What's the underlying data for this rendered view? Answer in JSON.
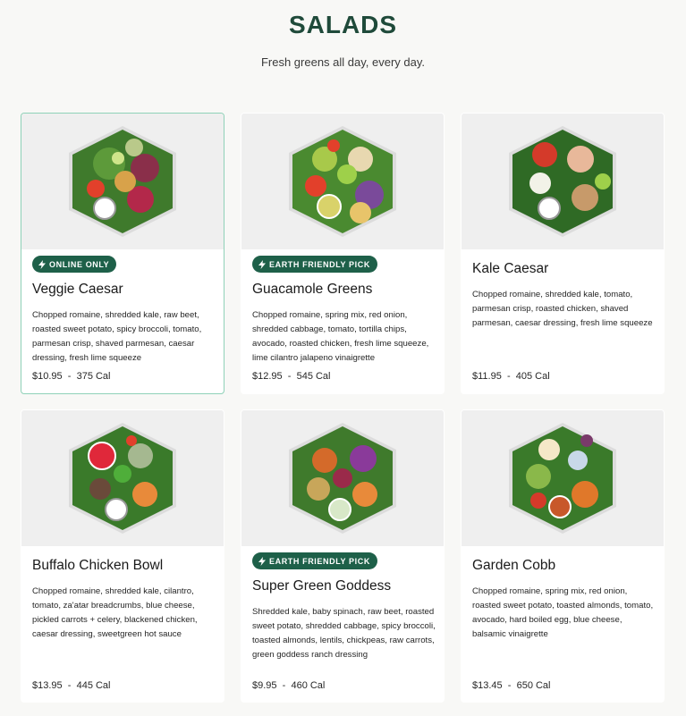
{
  "page": {
    "title": "SALADS",
    "subtitle": "Fresh greens all day, every day."
  },
  "products": [
    {
      "name": "Veggie Caesar",
      "badge": "ONLINE ONLY",
      "description": "Chopped romaine, shredded kale, raw beet, roasted sweet potato, spicy broccoli, tomato, parmesan crisp, shaved parmesan, caesar dressing, fresh lime squeeze",
      "price": "$10.95",
      "separator": "-",
      "calories": "375 Cal",
      "selected": true
    },
    {
      "name": "Guacamole Greens",
      "badge": "EARTH FRIENDLY PICK",
      "description": "Chopped romaine, spring mix, red onion, shredded cabbage, tomato, tortilla chips, avocado, roasted chicken, fresh lime squeeze, lime cilantro jalapeno vinaigrette",
      "price": "$12.95",
      "separator": "-",
      "calories": "545 Cal",
      "selected": false
    },
    {
      "name": "Kale Caesar",
      "badge": "",
      "description": "Chopped romaine, shredded kale, tomato, parmesan crisp, roasted chicken, shaved parmesan, caesar dressing, fresh lime squeeze",
      "price": "$11.95",
      "separator": "-",
      "calories": "405 Cal",
      "selected": false
    },
    {
      "name": "Buffalo Chicken Bowl",
      "badge": "",
      "description": "Chopped romaine, shredded kale, cilantro, tomato, za'atar breadcrumbs, blue cheese, pickled carrots + celery, blackened chicken, caesar dressing, sweetgreen hot sauce",
      "price": "$13.95",
      "separator": "-",
      "calories": "445 Cal",
      "selected": false
    },
    {
      "name": "Super Green Goddess",
      "badge": "EARTH FRIENDLY PICK",
      "description": "Shredded kale, baby spinach, raw beet, roasted sweet potato, shredded cabbage, spicy broccoli, toasted almonds, lentils, chickpeas, raw carrots, green goddess ranch dressing",
      "price": "$9.95",
      "separator": "-",
      "calories": "460 Cal",
      "selected": false
    },
    {
      "name": "Garden Cobb",
      "badge": "",
      "description": "Chopped romaine, spring mix, red onion, roasted sweet potato, toasted almonds, tomato, avocado, hard boiled egg, blue cheese, balsamic vinaigrette",
      "price": "$13.45",
      "separator": "-",
      "calories": "650 Cal",
      "selected": false
    }
  ],
  "icons": {
    "badge": "lightning-bolt-icon",
    "image": "salad-bowl-photo"
  },
  "colors": {
    "title": "#1f4a3a",
    "badge_bg": "#1e6049",
    "selected_border": "#8fd1b8",
    "image_bg": "#efefef",
    "page_bg": "#f8f8f6"
  }
}
